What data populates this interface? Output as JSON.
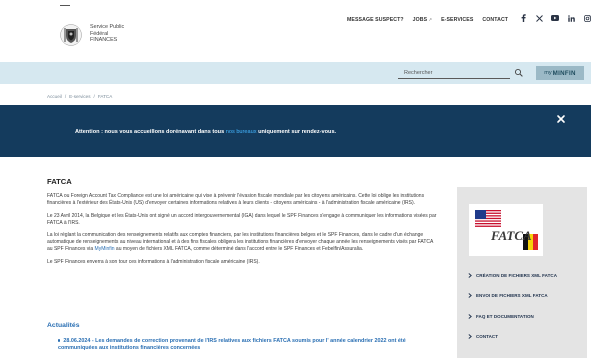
{
  "header": {
    "org_lines": [
      "Service Public",
      "Fédéral",
      "FINANCES"
    ],
    "nav": [
      {
        "label": "MESSAGE SUSPECT?",
        "external": false
      },
      {
        "label": "JOBS",
        "external": true
      },
      {
        "label": "E-SERVICES",
        "external": false
      },
      {
        "label": "CONTACT",
        "external": false
      }
    ],
    "external_mark": "↗",
    "social_icons": [
      "facebook-icon",
      "x-icon",
      "youtube-icon",
      "linkedin-icon",
      "instagram-icon"
    ]
  },
  "search": {
    "placeholder": "Rechercher",
    "myminfin_prefix": "my",
    "myminfin_brand": "MINFIN"
  },
  "breadcrumb": [
    "Accueil",
    "E-services",
    "FATCA"
  ],
  "banner": {
    "text_before": "Attention : nous vous accueillons dorénavant dans tous ",
    "link": "nos bureaux",
    "text_after": " uniquement sur rendez-vous."
  },
  "page": {
    "title": "FATCA",
    "paragraphs": [
      {
        "text": "FATCA ou Foreign Account Tax Compliance est une loi américaine qui vise à prévenir l'évasion fiscale mondiale par les citoyens américains. Cette loi oblige les institutions financières à l'extérieur des États-Unis (US) d'envoyer certaines informations relatives à leurs clients - citoyens américains - à l'administration fiscale américaine (IRS)."
      },
      {
        "text": "Le 23 Avril 2014, la Belgique et les États-Unis ont signé un accord intergouvernemental (IGA) dans lequel le SPF Finances s'engage à communiquer les informations visées par FATCA à l'IRS."
      },
      {
        "text_before": "La loi réglant la communication des renseignements relatifs aux comptes financiers, par les institutions financières belges et le SPF Finances, dans le cadre d'un échange automatique de renseignements au niveau international et à des fins fiscales obligera les institutions financières d'envoyer chaque année les renseignements visés par FATCA au SPF Finances via ",
        "link": "MyMinfin",
        "text_after": " au moyen de fichiers XML FATCA, comme déterminé dans l'accord entre le SPF Finances et Febelfin/Assuralia."
      },
      {
        "text": "Le SPF Finances enverra à son tour ces informations à l'administration fiscale américaine (IRS)."
      }
    ],
    "news_heading": "Actualités",
    "news": [
      {
        "text": "28.06.2024 - Les demandes de correction provenant de l'IRS relatives aux fichiers FATCA soumis pour l' année calendrier 2022 ont été communiquées aux institutions financières concernées"
      }
    ]
  },
  "sidebar": {
    "logo_text": "FATCA",
    "links": [
      {
        "label": "CRÉATION DE FICHIERS XML FATCA",
        "external": false
      },
      {
        "label": "ENVOI DE FICHIERS XML FATCA",
        "external": false
      },
      {
        "label": "FAQ ET DOCUMENTATION",
        "external": false
      },
      {
        "label": "CONTACT",
        "external": false
      }
    ]
  },
  "colors": {
    "banner_bg": "#143b5d",
    "banner_link": "#44b6ff",
    "searchbar_bg": "#d6e8f0",
    "link_blue": "#2a6fb3",
    "sidebar_bg": "#e4e4e4"
  }
}
